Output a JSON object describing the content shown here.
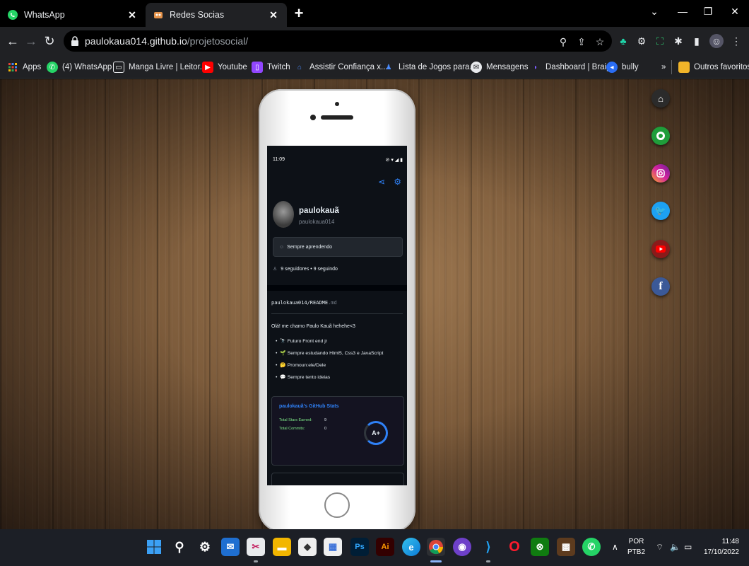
{
  "browser": {
    "tabs": [
      {
        "title": "WhatsApp",
        "active": false
      },
      {
        "title": "Redes Socias",
        "active": true
      }
    ],
    "url_domain": "paulokaua014.github.io",
    "url_path": "/projetosocial/",
    "bookmarks": [
      {
        "label": "Apps",
        "icon": "apps-grid-icon"
      },
      {
        "label": "(4) WhatsApp",
        "icon": "whatsapp-icon"
      },
      {
        "label": "Manga Livre | Leitor...",
        "icon": "manga-icon"
      },
      {
        "label": "Youtube",
        "icon": "youtube-icon"
      },
      {
        "label": "Twitch",
        "icon": "twitch-icon"
      },
      {
        "label": "Assistir Confiança x...",
        "icon": "tv-icon"
      },
      {
        "label": "Lista de Jogos para...",
        "icon": "game-icon"
      },
      {
        "label": "Mensagens",
        "icon": "messages-icon"
      },
      {
        "label": "Dashboard | Braip",
        "icon": "braip-icon"
      },
      {
        "label": "bully",
        "icon": "bully-icon"
      }
    ],
    "more_bookmarks": "»",
    "other_favorites": "Outros favoritos"
  },
  "profile": {
    "status_time": "11:09",
    "name": "paulokauã",
    "username": "paulokaua014",
    "bio": "Sempre aprendendo",
    "followers": "9 seguidores • 9 seguindo",
    "readme_path": "paulokaua014/README",
    "readme_ext": ".md",
    "greeting": "Olá! me chamo Paulo Kauã hehehe<3",
    "list": [
      "🔭 Futuro Front end jr",
      "🌱 Sempre estudando Html5, Css3 e JavaScript",
      "🤔 Promoun:ele/Dele",
      "💬 Sempre tento ideias"
    ],
    "stats_title": "paulokauã's GitHub Stats",
    "stats_rows": [
      {
        "label": "Total Stars Earned:",
        "value": "9"
      },
      {
        "label": "Total Commits:",
        "value": "0"
      }
    ],
    "grade": "A+"
  },
  "social_links": [
    {
      "name": "home",
      "color": "#2b2b2b"
    },
    {
      "name": "github",
      "color": "#1f9d3a"
    },
    {
      "name": "instagram",
      "color": "#d6249f"
    },
    {
      "name": "twitter",
      "color": "#1da1f2"
    },
    {
      "name": "youtube",
      "color": "#c4302b"
    },
    {
      "name": "facebook",
      "color": "#3b5998"
    }
  ],
  "taskbar": {
    "language": "POR",
    "layout": "PTB2",
    "time": "11:48",
    "date": "17/10/2022"
  }
}
